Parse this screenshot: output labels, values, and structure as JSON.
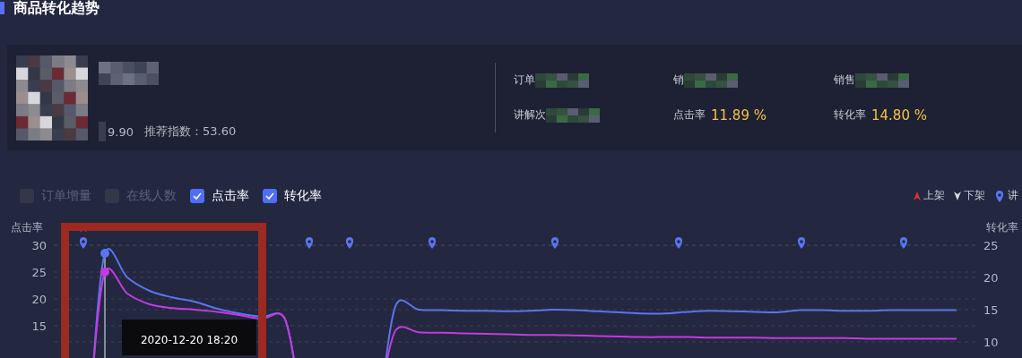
{
  "section_title": "商品转化趋势",
  "product": {
    "name": {
      "kind": "redacted"
    },
    "price": "9.90",
    "recommend": "推荐指数：53.60"
  },
  "stats": [
    {
      "label": "订单",
      "kind": "redacted"
    },
    {
      "label": "销",
      "kind": "redacted"
    },
    {
      "label": "销售",
      "kind": "redacted"
    },
    {
      "label": "讲解次",
      "kind": "redacted"
    },
    {
      "label": "点击率",
      "kind": "value",
      "value": "11.89 %"
    },
    {
      "label": "转化率",
      "kind": "value",
      "value": "14.80 %"
    }
  ],
  "series_toggles": [
    {
      "label": "订单增量",
      "checked": false
    },
    {
      "label": "在线人数",
      "checked": false
    },
    {
      "label": "点击率",
      "checked": true
    },
    {
      "label": "转化率",
      "checked": true
    }
  ],
  "legend": [
    {
      "kind": "up",
      "label": "上架"
    },
    {
      "kind": "down",
      "label": "下架"
    },
    {
      "kind": "pin",
      "label": "讲"
    }
  ],
  "chart": {
    "left_axis_label": "点击率",
    "right_axis_label": "转化率",
    "right_ticks": [
      "25",
      "20",
      "15",
      "10"
    ],
    "tooltip": {
      "label": "2020-12-20 18:20"
    },
    "markers": [
      {
        "kind": "up"
      },
      {
        "kind": "pin"
      },
      {
        "kind": "pin"
      },
      {
        "kind": "pin"
      },
      {
        "kind": "pin"
      },
      {
        "kind": "pin"
      },
      {
        "kind": "pin"
      },
      {
        "kind": "pin"
      },
      {
        "kind": "pin"
      }
    ],
    "chart_data": {
      "type": "line",
      "grid": true,
      "ylim": [
        9,
        30
      ],
      "yticks": [
        15,
        20,
        25,
        30
      ],
      "series": [
        {
          "color": "#5b74f0",
          "values": [
            null,
            null,
            28.5,
            24,
            21.5,
            20.3,
            19.5,
            18.2,
            17.3,
            16.7,
            16.5,
            null,
            null,
            null,
            null,
            19,
            18,
            17.9,
            17.8,
            17.8,
            17.7,
            17.8,
            18,
            17.9,
            17.7,
            17.5,
            17.3,
            17.3,
            17.6,
            17.8,
            17.7,
            17.6,
            17.5,
            17.9,
            17.9,
            17.8,
            17.8,
            17.9,
            17.9,
            17.9,
            17.9
          ]
        },
        {
          "color": "#c43adf",
          "values": [
            null,
            null,
            25,
            21,
            19,
            18.3,
            18,
            17.6,
            17,
            16.3,
            16.6,
            null,
            null,
            null,
            null,
            14.3,
            13.8,
            13.7,
            13.6,
            13.5,
            13.4,
            13.3,
            13.3,
            13.2,
            13.1,
            13,
            12.9,
            12.9,
            12.9,
            12.8,
            12.8,
            12.8,
            12.7,
            12.7,
            12.7,
            12.7,
            12.6,
            12.6,
            12.6,
            12.6,
            12.6
          ]
        }
      ]
    }
  }
}
